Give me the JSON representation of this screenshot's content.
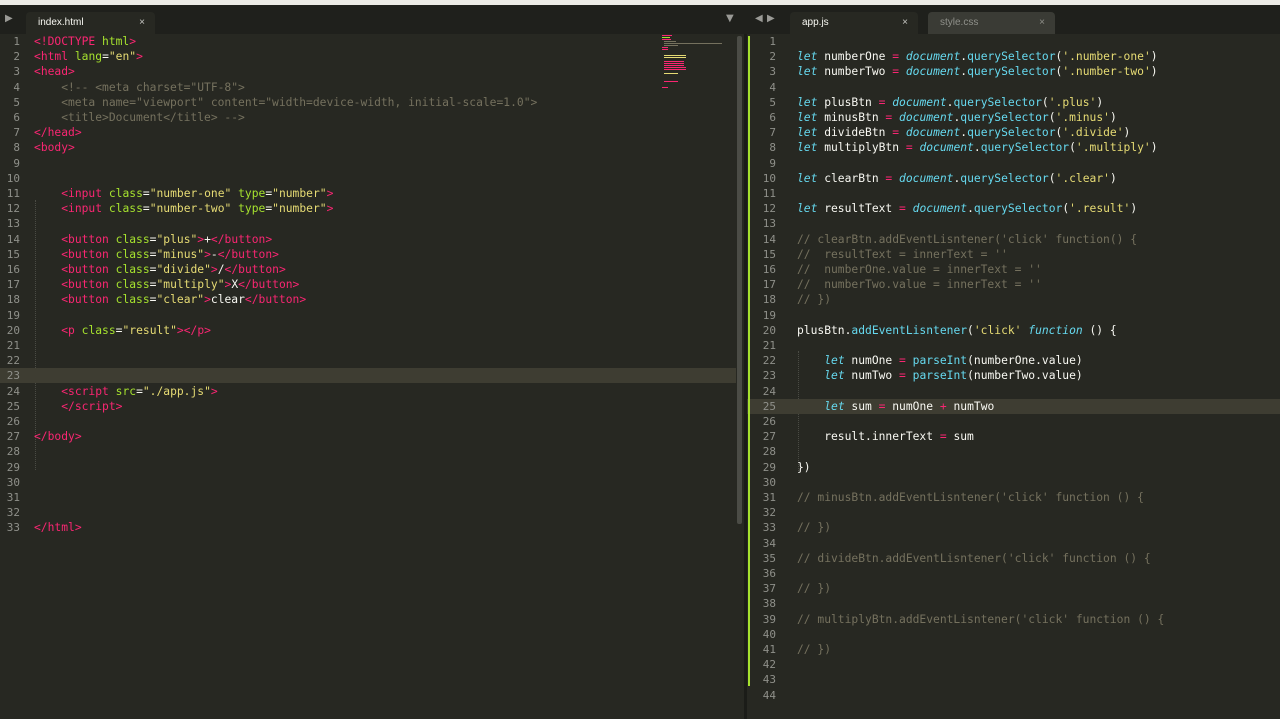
{
  "window": {
    "left_tabs": [
      {
        "label": "index.html",
        "active": true
      }
    ],
    "right_tabs": [
      {
        "label": "app.js",
        "active": true
      },
      {
        "label": "style.css",
        "active": false
      }
    ],
    "close_glyph": "×",
    "dropdown_glyph": "▼",
    "nav_left_glyph": "◀",
    "nav_right_glyph": "▶"
  },
  "theme": {
    "background": "#272822",
    "keyword": "#f92672",
    "string": "#e6db74",
    "attribute": "#a6e22e",
    "comment": "#75715e",
    "builtin": "#66d9ef"
  },
  "left_editor": {
    "file": "index.html",
    "highlight_line": 23,
    "lines": [
      [
        [
          "t",
          "<!"
        ],
        [
          "k",
          "DOCTYPE"
        ],
        [
          "p",
          " "
        ],
        [
          "a",
          "html"
        ],
        [
          "t",
          ">"
        ]
      ],
      [
        [
          "t",
          "<"
        ],
        [
          "k",
          "html"
        ],
        [
          "p",
          " "
        ],
        [
          "a",
          "lang"
        ],
        [
          "p",
          "="
        ],
        [
          "s",
          "\"en\""
        ],
        [
          "t",
          ">"
        ]
      ],
      [
        [
          "t",
          "<"
        ],
        [
          "k",
          "head"
        ],
        [
          "t",
          ">"
        ]
      ],
      [
        [
          "c",
          "    <!-- <meta charset=\"UTF-8\">"
        ]
      ],
      [
        [
          "c",
          "    <meta name=\"viewport\" content=\"width=device-width, initial-scale=1.0\">"
        ]
      ],
      [
        [
          "c",
          "    <title>Document</title> -->"
        ]
      ],
      [
        [
          "t",
          "</"
        ],
        [
          "k",
          "head"
        ],
        [
          "t",
          ">"
        ]
      ],
      [
        [
          "t",
          "<"
        ],
        [
          "k",
          "body"
        ],
        [
          "t",
          ">"
        ]
      ],
      [],
      [],
      [
        [
          "p",
          "    "
        ],
        [
          "t",
          "<"
        ],
        [
          "k",
          "input"
        ],
        [
          "p",
          " "
        ],
        [
          "a",
          "class"
        ],
        [
          "p",
          "="
        ],
        [
          "s",
          "\"number-one\""
        ],
        [
          "p",
          " "
        ],
        [
          "a",
          "type"
        ],
        [
          "p",
          "="
        ],
        [
          "s",
          "\"number\""
        ],
        [
          "t",
          ">"
        ]
      ],
      [
        [
          "p",
          "    "
        ],
        [
          "t",
          "<"
        ],
        [
          "k",
          "input"
        ],
        [
          "p",
          " "
        ],
        [
          "a",
          "class"
        ],
        [
          "p",
          "="
        ],
        [
          "s",
          "\"number-two\""
        ],
        [
          "p",
          " "
        ],
        [
          "a",
          "type"
        ],
        [
          "p",
          "="
        ],
        [
          "s",
          "\"number\""
        ],
        [
          "t",
          ">"
        ]
      ],
      [],
      [
        [
          "p",
          "    "
        ],
        [
          "t",
          "<"
        ],
        [
          "k",
          "button"
        ],
        [
          "p",
          " "
        ],
        [
          "a",
          "class"
        ],
        [
          "p",
          "="
        ],
        [
          "s",
          "\"plus\""
        ],
        [
          "t",
          ">"
        ],
        [
          "p",
          "+"
        ],
        [
          "t",
          "</"
        ],
        [
          "k",
          "button"
        ],
        [
          "t",
          ">"
        ]
      ],
      [
        [
          "p",
          "    "
        ],
        [
          "t",
          "<"
        ],
        [
          "k",
          "button"
        ],
        [
          "p",
          " "
        ],
        [
          "a",
          "class"
        ],
        [
          "p",
          "="
        ],
        [
          "s",
          "\"minus\""
        ],
        [
          "t",
          ">"
        ],
        [
          "p",
          "-"
        ],
        [
          "t",
          "</"
        ],
        [
          "k",
          "button"
        ],
        [
          "t",
          ">"
        ]
      ],
      [
        [
          "p",
          "    "
        ],
        [
          "t",
          "<"
        ],
        [
          "k",
          "button"
        ],
        [
          "p",
          " "
        ],
        [
          "a",
          "class"
        ],
        [
          "p",
          "="
        ],
        [
          "s",
          "\"divide\""
        ],
        [
          "t",
          ">"
        ],
        [
          "p",
          "/"
        ],
        [
          "t",
          "</"
        ],
        [
          "k",
          "button"
        ],
        [
          "t",
          ">"
        ]
      ],
      [
        [
          "p",
          "    "
        ],
        [
          "t",
          "<"
        ],
        [
          "k",
          "button"
        ],
        [
          "p",
          " "
        ],
        [
          "a",
          "class"
        ],
        [
          "p",
          "="
        ],
        [
          "s",
          "\"multiply\""
        ],
        [
          "t",
          ">"
        ],
        [
          "p",
          "X"
        ],
        [
          "t",
          "</"
        ],
        [
          "k",
          "button"
        ],
        [
          "t",
          ">"
        ]
      ],
      [
        [
          "p",
          "    "
        ],
        [
          "t",
          "<"
        ],
        [
          "k",
          "button"
        ],
        [
          "p",
          " "
        ],
        [
          "a",
          "class"
        ],
        [
          "p",
          "="
        ],
        [
          "s",
          "\"clear\""
        ],
        [
          "t",
          ">"
        ],
        [
          "p",
          "clear"
        ],
        [
          "t",
          "</"
        ],
        [
          "k",
          "button"
        ],
        [
          "t",
          ">"
        ]
      ],
      [],
      [
        [
          "p",
          "    "
        ],
        [
          "t",
          "<"
        ],
        [
          "k",
          "p"
        ],
        [
          "p",
          " "
        ],
        [
          "a",
          "class"
        ],
        [
          "p",
          "="
        ],
        [
          "s",
          "\"result\""
        ],
        [
          "t",
          "></"
        ],
        [
          "k",
          "p"
        ],
        [
          "t",
          ">"
        ]
      ],
      [],
      [],
      [],
      [
        [
          "p",
          "    "
        ],
        [
          "t",
          "<"
        ],
        [
          "k",
          "script"
        ],
        [
          "p",
          " "
        ],
        [
          "a",
          "src"
        ],
        [
          "p",
          "="
        ],
        [
          "s",
          "\"./app.js\""
        ],
        [
          "t",
          ">"
        ]
      ],
      [
        [
          "p",
          "    "
        ],
        [
          "t",
          "</"
        ],
        [
          "k",
          "script"
        ],
        [
          "t",
          ">"
        ]
      ],
      [],
      [
        [
          "t",
          "</"
        ],
        [
          "k",
          "body"
        ],
        [
          "t",
          ">"
        ]
      ],
      [],
      [],
      [],
      [],
      [],
      [
        [
          "t",
          "</"
        ],
        [
          "k",
          "html"
        ],
        [
          "t",
          ">"
        ]
      ]
    ]
  },
  "right_editor": {
    "file": "app.js",
    "highlight_line": 25,
    "lines": [
      [],
      [
        [
          "sb",
          "let"
        ],
        [
          "p",
          " numberOne "
        ],
        [
          "k",
          "="
        ],
        [
          "p",
          " "
        ],
        [
          "sb",
          "document"
        ],
        [
          "p",
          "."
        ],
        [
          "fn",
          "querySelector"
        ],
        [
          "p",
          "("
        ],
        [
          "s",
          "'.number-one'"
        ],
        [
          "p",
          ")"
        ]
      ],
      [
        [
          "sb",
          "let"
        ],
        [
          "p",
          " numberTwo "
        ],
        [
          "k",
          "="
        ],
        [
          "p",
          " "
        ],
        [
          "sb",
          "document"
        ],
        [
          "p",
          "."
        ],
        [
          "fn",
          "querySelector"
        ],
        [
          "p",
          "("
        ],
        [
          "s",
          "'.number-two'"
        ],
        [
          "p",
          ")"
        ]
      ],
      [],
      [
        [
          "sb",
          "let"
        ],
        [
          "p",
          " plusBtn "
        ],
        [
          "k",
          "="
        ],
        [
          "p",
          " "
        ],
        [
          "sb",
          "document"
        ],
        [
          "p",
          "."
        ],
        [
          "fn",
          "querySelector"
        ],
        [
          "p",
          "("
        ],
        [
          "s",
          "'.plus'"
        ],
        [
          "p",
          ")"
        ]
      ],
      [
        [
          "sb",
          "let"
        ],
        [
          "p",
          " minusBtn "
        ],
        [
          "k",
          "="
        ],
        [
          "p",
          " "
        ],
        [
          "sb",
          "document"
        ],
        [
          "p",
          "."
        ],
        [
          "fn",
          "querySelector"
        ],
        [
          "p",
          "("
        ],
        [
          "s",
          "'.minus'"
        ],
        [
          "p",
          ")"
        ]
      ],
      [
        [
          "sb",
          "let"
        ],
        [
          "p",
          " divideBtn "
        ],
        [
          "k",
          "="
        ],
        [
          "p",
          " "
        ],
        [
          "sb",
          "document"
        ],
        [
          "p",
          "."
        ],
        [
          "fn",
          "querySelector"
        ],
        [
          "p",
          "("
        ],
        [
          "s",
          "'.divide'"
        ],
        [
          "p",
          ")"
        ]
      ],
      [
        [
          "sb",
          "let"
        ],
        [
          "p",
          " multiplyBtn "
        ],
        [
          "k",
          "="
        ],
        [
          "p",
          " "
        ],
        [
          "sb",
          "document"
        ],
        [
          "p",
          "."
        ],
        [
          "fn",
          "querySelector"
        ],
        [
          "p",
          "("
        ],
        [
          "s",
          "'.multiply'"
        ],
        [
          "p",
          ")"
        ]
      ],
      [],
      [
        [
          "sb",
          "let"
        ],
        [
          "p",
          " clearBtn "
        ],
        [
          "k",
          "="
        ],
        [
          "p",
          " "
        ],
        [
          "sb",
          "document"
        ],
        [
          "p",
          "."
        ],
        [
          "fn",
          "querySelector"
        ],
        [
          "p",
          "("
        ],
        [
          "s",
          "'.clear'"
        ],
        [
          "p",
          ")"
        ]
      ],
      [],
      [
        [
          "sb",
          "let"
        ],
        [
          "p",
          " resultText "
        ],
        [
          "k",
          "="
        ],
        [
          "p",
          " "
        ],
        [
          "sb",
          "document"
        ],
        [
          "p",
          "."
        ],
        [
          "fn",
          "querySelector"
        ],
        [
          "p",
          "("
        ],
        [
          "s",
          "'.result'"
        ],
        [
          "p",
          ")"
        ]
      ],
      [],
      [
        [
          "c",
          "// clearBtn.addEventLisntener('click' function() {"
        ]
      ],
      [
        [
          "c",
          "//  resultText = innerText = ''"
        ]
      ],
      [
        [
          "c",
          "//  numberOne.value = innerText = ''"
        ]
      ],
      [
        [
          "c",
          "//  numberTwo.value = innerText = ''"
        ]
      ],
      [
        [
          "c",
          "// })"
        ]
      ],
      [],
      [
        [
          "p",
          "plusBtn."
        ],
        [
          "fn",
          "addEventLisntener"
        ],
        [
          "p",
          "("
        ],
        [
          "s",
          "'click'"
        ],
        [
          "p",
          " "
        ],
        [
          "sb",
          "function"
        ],
        [
          "p",
          " () {"
        ]
      ],
      [],
      [
        [
          "p",
          "    "
        ],
        [
          "sb",
          "let"
        ],
        [
          "p",
          " numOne "
        ],
        [
          "k",
          "="
        ],
        [
          "p",
          " "
        ],
        [
          "fn",
          "parseInt"
        ],
        [
          "p",
          "(numberOne.value)"
        ]
      ],
      [
        [
          "p",
          "    "
        ],
        [
          "sb",
          "let"
        ],
        [
          "p",
          " numTwo "
        ],
        [
          "k",
          "="
        ],
        [
          "p",
          " "
        ],
        [
          "fn",
          "parseInt"
        ],
        [
          "p",
          "(numberTwo.value)"
        ]
      ],
      [],
      [
        [
          "p",
          "    "
        ],
        [
          "sb",
          "let"
        ],
        [
          "p",
          " sum "
        ],
        [
          "k",
          "="
        ],
        [
          "p",
          " numOne "
        ],
        [
          "k",
          "+"
        ],
        [
          "p",
          " numTwo"
        ]
      ],
      [],
      [
        [
          "p",
          "    result.innerText "
        ],
        [
          "k",
          "="
        ],
        [
          "p",
          " sum"
        ]
      ],
      [],
      [
        [
          "p",
          "})"
        ]
      ],
      [],
      [
        [
          "c",
          "// minusBtn.addEventLisntener('click' function () {"
        ]
      ],
      [],
      [
        [
          "c",
          "// })"
        ]
      ],
      [],
      [
        [
          "c",
          "// divideBtn.addEventLisntener('click' function () {"
        ]
      ],
      [],
      [
        [
          "c",
          "// })"
        ]
      ],
      [],
      [
        [
          "c",
          "// multiplyBtn.addEventLisntener('click' function () {"
        ]
      ],
      [],
      [
        [
          "c",
          "// })"
        ]
      ],
      [],
      [],
      []
    ]
  }
}
